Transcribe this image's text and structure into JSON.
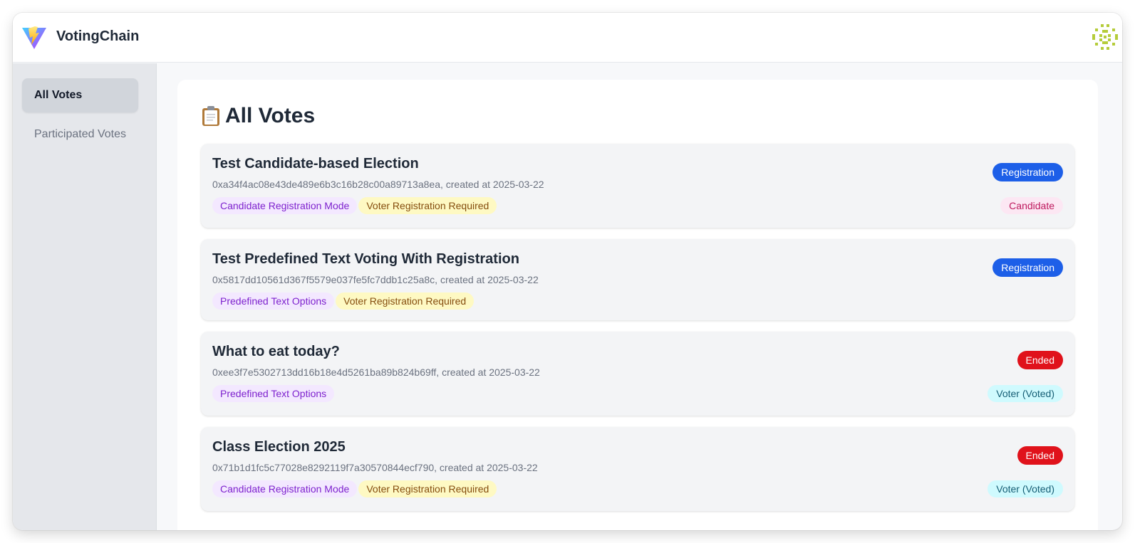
{
  "header": {
    "app_title": "VotingChain"
  },
  "sidebar": {
    "items": [
      {
        "label": "All Votes",
        "active": true
      },
      {
        "label": "Participated Votes",
        "active": false
      }
    ]
  },
  "main": {
    "title": "All Votes",
    "votes": [
      {
        "title": "Test Candidate-based Election",
        "address": "0xa34f4ac08e43de489e6b3c16b28c00a89713a8ea",
        "created": "2025-03-22",
        "subtitle": "0xa34f4ac08e43de489e6b3c16b28c00a89713a8ea, created at 2025-03-22",
        "tags": [
          "Candidate Registration Mode",
          "Voter Registration Required"
        ],
        "status": "Registration",
        "role": "Candidate"
      },
      {
        "title": "Test Predefined Text Voting With Registration",
        "address": "0x5817dd10561d367f5579e037fe5fc7ddb1c25a8c",
        "created": "2025-03-22",
        "subtitle": "0x5817dd10561d367f5579e037fe5fc7ddb1c25a8c, created at 2025-03-22",
        "tags": [
          "Predefined Text Options",
          "Voter Registration Required"
        ],
        "status": "Registration",
        "role": ""
      },
      {
        "title": "What to eat today?",
        "address": "0xee3f7e5302713dd16b18e4d5261ba89b824b69ff",
        "created": "2025-03-22",
        "subtitle": "0xee3f7e5302713dd16b18e4d5261ba89b824b69ff, created at 2025-03-22",
        "tags": [
          "Predefined Text Options"
        ],
        "status": "Ended",
        "role": "Voter (Voted)"
      },
      {
        "title": "Class Election 2025",
        "address": "0x71b1d1fc5c77028e8292119f7a30570844ecf790",
        "created": "2025-03-22",
        "subtitle": "0x71b1d1fc5c77028e8292119f7a30570844ecf790, created at 2025-03-22",
        "tags": [
          "Candidate Registration Mode",
          "Voter Registration Required"
        ],
        "status": "Ended",
        "role": "Voter (Voted)"
      }
    ]
  },
  "colors": {
    "status_registration": "#1d5fe8",
    "status_ended": "#e0121b",
    "tag_purple_bg": "#f3e8ff",
    "tag_yellow_bg": "#fef9c3",
    "role_candidate_bg": "#fce7f3",
    "role_voter_bg": "#cffafe"
  }
}
